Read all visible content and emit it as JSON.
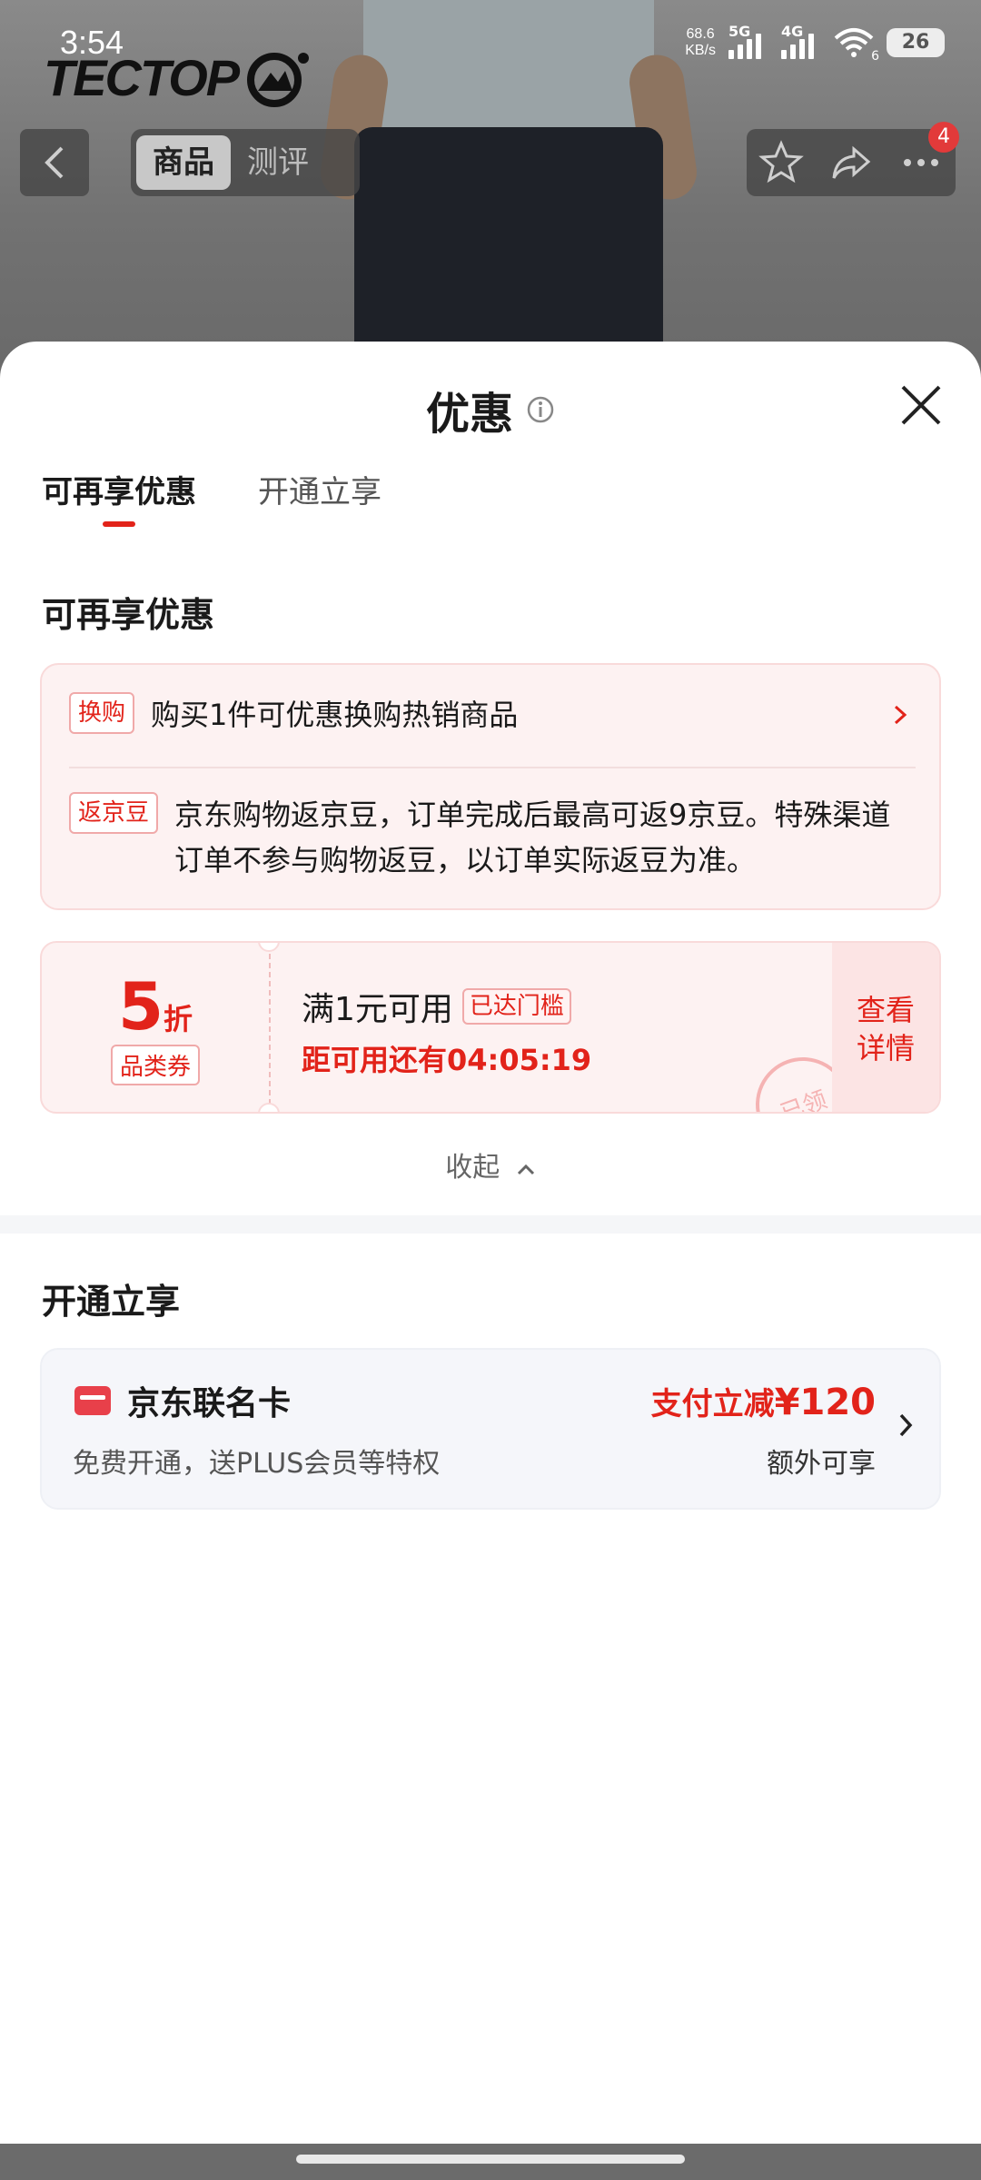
{
  "status_bar": {
    "time": "3:54",
    "net_speed_value": "68.6",
    "net_speed_unit": "KB/s",
    "sig1_label": "5G",
    "sig2_label": "4G",
    "wifi_sub": "6",
    "battery": "26"
  },
  "brand": {
    "logo_text": "TECTOP"
  },
  "header": {
    "tabs": [
      "商品",
      "测评"
    ],
    "cart_badge": "4"
  },
  "sheet": {
    "title": "优惠",
    "tabs": [
      "可再享优惠",
      "开通立享"
    ],
    "section1_title": "可再享优惠",
    "benefits": [
      {
        "tag": "换购",
        "text": "购买1件可优惠换购热销商品"
      },
      {
        "tag": "返京豆",
        "text": "京东购物返京豆，订单完成后最高可返9京豆。特殊渠道订单不参与购物返豆，以订单实际返豆为准。"
      }
    ],
    "coupon": {
      "value": "5",
      "unit": "折",
      "type": "品类券",
      "condition": "满1元可用",
      "flag": "已达门槛",
      "countdown": "距可用还有04:05:19",
      "action_line1": "查看",
      "action_line2": "详情",
      "stamp": "已领"
    },
    "collapse_label": "收起",
    "section2_title": "开通立享",
    "card": {
      "title": "京东联名卡",
      "subtitle": "免费开通，送PLUS会员等特权",
      "promo_prefix": "支付立减",
      "promo_amount": "¥120",
      "extra": "额外可享"
    }
  },
  "colors": {
    "accent": "#e2231a",
    "pink_bg": "#fdf2f2"
  }
}
